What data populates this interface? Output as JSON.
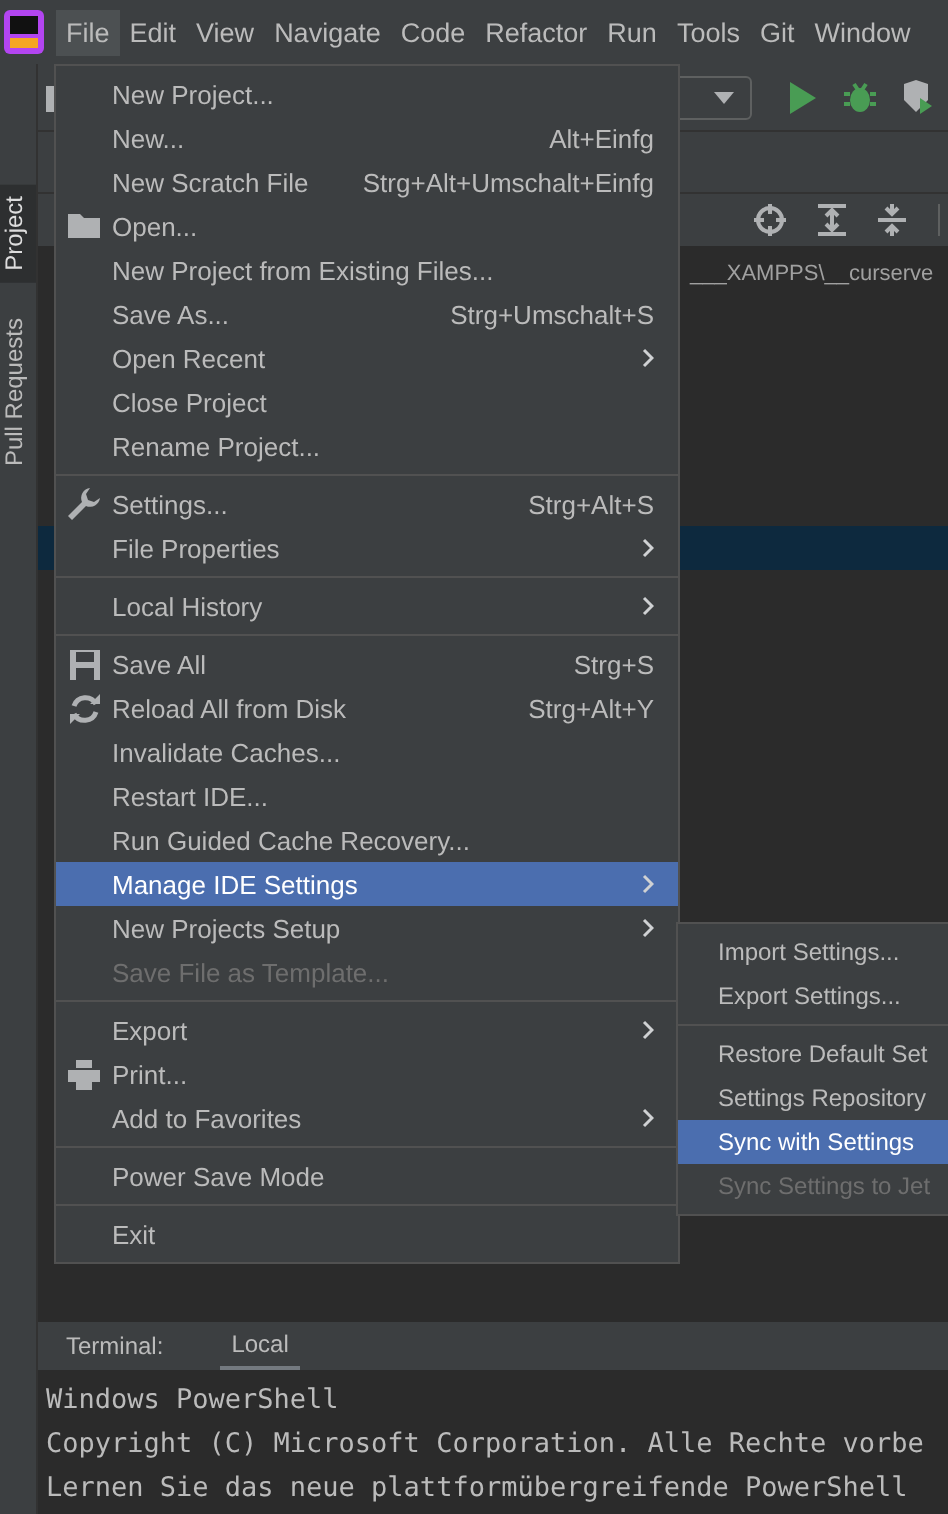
{
  "menu_bar": [
    {
      "label": "File",
      "selected": true
    },
    {
      "label": "Edit",
      "selected": false
    },
    {
      "label": "View",
      "selected": false
    },
    {
      "label": "Navigate",
      "selected": false
    },
    {
      "label": "Code",
      "selected": false
    },
    {
      "label": "Refactor",
      "selected": false
    },
    {
      "label": "Run",
      "selected": false
    },
    {
      "label": "Tools",
      "selected": false
    },
    {
      "label": "Git",
      "selected": false
    },
    {
      "label": "Window",
      "selected": false
    }
  ],
  "tool_windows": [
    {
      "label": "Project",
      "selected": true
    },
    {
      "label": "Pull Requests",
      "selected": false
    }
  ],
  "editor": {
    "path": "___XAMPPS\\__curserve"
  },
  "file_menu": {
    "groups": [
      [
        {
          "label": "New Project...",
          "submenu": false,
          "selected": false,
          "disabled": false
        },
        {
          "label": "New...",
          "shortcut": "Alt+Einfg",
          "submenu": false,
          "selected": false,
          "disabled": false
        },
        {
          "label": "New Scratch File",
          "shortcut": "Strg+Alt+Umschalt+Einfg",
          "submenu": false,
          "selected": false,
          "disabled": false
        },
        {
          "label": "Open...",
          "submenu": false,
          "selected": false,
          "disabled": false
        },
        {
          "label": "New Project from Existing Files...",
          "submenu": false,
          "selected": false,
          "disabled": false
        },
        {
          "label": "Save As...",
          "shortcut": "Strg+Umschalt+S",
          "submenu": false,
          "selected": false,
          "disabled": false
        },
        {
          "label": "Open Recent",
          "submenu": true,
          "selected": false,
          "disabled": false
        },
        {
          "label": "Close Project",
          "submenu": false,
          "selected": false,
          "disabled": false
        },
        {
          "label": "Rename Project...",
          "submenu": false,
          "selected": false,
          "disabled": false
        }
      ],
      [
        {
          "label": "Settings...",
          "shortcut": "Strg+Alt+S",
          "submenu": false,
          "selected": false,
          "disabled": false
        },
        {
          "label": "File Properties",
          "submenu": true,
          "selected": false,
          "disabled": false
        }
      ],
      [
        {
          "label": "Local History",
          "submenu": true,
          "selected": false,
          "disabled": false
        }
      ],
      [
        {
          "label": "Save All",
          "shortcut": "Strg+S",
          "submenu": false,
          "selected": false,
          "disabled": false
        },
        {
          "label": "Reload All from Disk",
          "shortcut": "Strg+Alt+Y",
          "submenu": false,
          "selected": false,
          "disabled": false
        },
        {
          "label": "Invalidate Caches...",
          "submenu": false,
          "selected": false,
          "disabled": false
        },
        {
          "label": "Restart IDE...",
          "submenu": false,
          "selected": false,
          "disabled": false
        },
        {
          "label": "Run Guided Cache Recovery...",
          "submenu": false,
          "selected": false,
          "disabled": false
        },
        {
          "label": "Manage IDE Settings",
          "submenu": true,
          "selected": true,
          "disabled": false
        },
        {
          "label": "New Projects Setup",
          "submenu": true,
          "selected": false,
          "disabled": false
        },
        {
          "label": "Save File as Template...",
          "submenu": false,
          "selected": false,
          "disabled": true
        }
      ],
      [
        {
          "label": "Export",
          "submenu": true,
          "selected": false,
          "disabled": false
        },
        {
          "label": "Print...",
          "submenu": false,
          "selected": false,
          "disabled": false
        },
        {
          "label": "Add to Favorites",
          "submenu": true,
          "selected": false,
          "disabled": false
        }
      ],
      [
        {
          "label": "Power Save Mode",
          "submenu": false,
          "selected": false,
          "disabled": false
        }
      ],
      [
        {
          "label": "Exit",
          "submenu": false,
          "selected": false,
          "disabled": false
        }
      ]
    ]
  },
  "settings_submenu": {
    "groups": [
      [
        {
          "label": "Import Settings...",
          "selected": false,
          "disabled": false
        },
        {
          "label": "Export Settings...",
          "selected": false,
          "disabled": false
        }
      ],
      [
        {
          "label": "Restore Default Set",
          "selected": false,
          "disabled": false
        },
        {
          "label": "Settings Repository",
          "selected": false,
          "disabled": false
        },
        {
          "label": "Sync with Settings",
          "selected": true,
          "disabled": false
        },
        {
          "label": "Sync Settings to Jet",
          "selected": false,
          "disabled": true
        }
      ]
    ]
  },
  "terminal": {
    "tabs": [
      {
        "label": "Terminal:",
        "selected": false
      },
      {
        "label": "Local",
        "selected": true
      }
    ],
    "lines": [
      "Windows PowerShell",
      "Copyright (C) Microsoft Corporation. Alle Rechte vorbe",
      "Lernen Sie das neue plattformübergreifende PowerShell"
    ]
  }
}
